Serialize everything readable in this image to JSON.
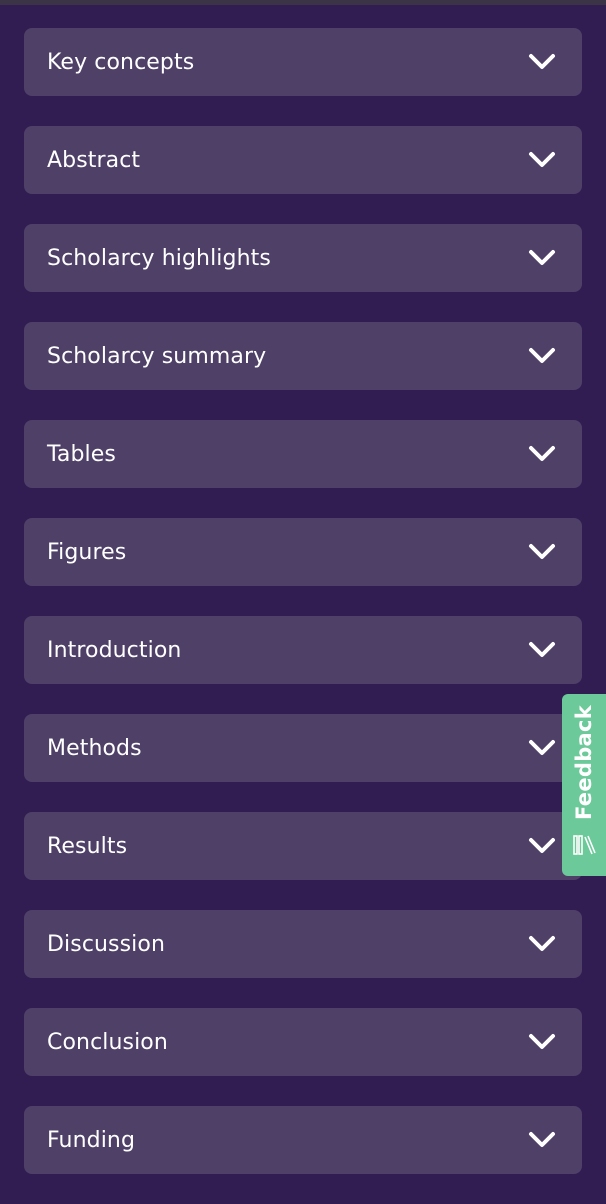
{
  "accordion": {
    "items": [
      {
        "label": "Key concepts"
      },
      {
        "label": "Abstract"
      },
      {
        "label": "Scholarcy highlights"
      },
      {
        "label": "Scholarcy summary"
      },
      {
        "label": "Tables"
      },
      {
        "label": "Figures"
      },
      {
        "label": "Introduction"
      },
      {
        "label": "Methods"
      },
      {
        "label": "Results"
      },
      {
        "label": "Discussion"
      },
      {
        "label": "Conclusion"
      },
      {
        "label": "Funding"
      }
    ],
    "toggle_icon": "chevron-down-icon"
  },
  "feedback": {
    "label": "Feedback",
    "icon": "books-icon"
  },
  "colors": {
    "background": "#311d52",
    "item_background": "#4f4068",
    "text": "#ffffff",
    "feedback_tab": "#6cc99a"
  }
}
